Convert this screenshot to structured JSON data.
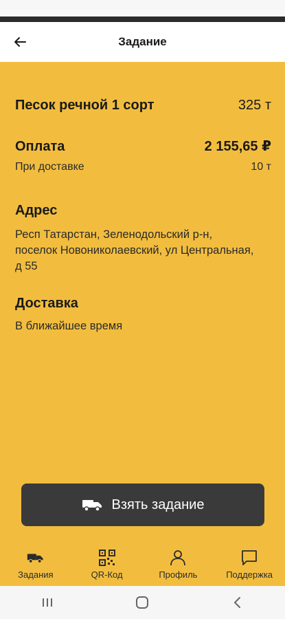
{
  "header": {
    "title": "Задание"
  },
  "product": {
    "name": "Песок речной 1 сорт",
    "qty": "325 т"
  },
  "payment": {
    "label": "Оплата",
    "amount": "2 155,65 ₽",
    "sub_label": "При доставке",
    "sub_value": "10 т"
  },
  "address": {
    "title": "Адрес",
    "text": "Респ Татарстан, Зеленодольский р-н, поселок Новониколаевский, ул Центральная, д 55"
  },
  "delivery": {
    "title": "Доставка",
    "text": "В ближайшее время"
  },
  "action": {
    "take_label": "Взять задание"
  },
  "nav": [
    {
      "label": "Задания",
      "icon": "truck-icon"
    },
    {
      "label": "QR-Код",
      "icon": "qr-code-icon"
    },
    {
      "label": "Профиль",
      "icon": "user-icon"
    },
    {
      "label": "Поддержка",
      "icon": "chat-icon"
    }
  ],
  "colors": {
    "background": "#f2bd3f",
    "button": "#3a3a3a",
    "header": "#ffffff"
  }
}
